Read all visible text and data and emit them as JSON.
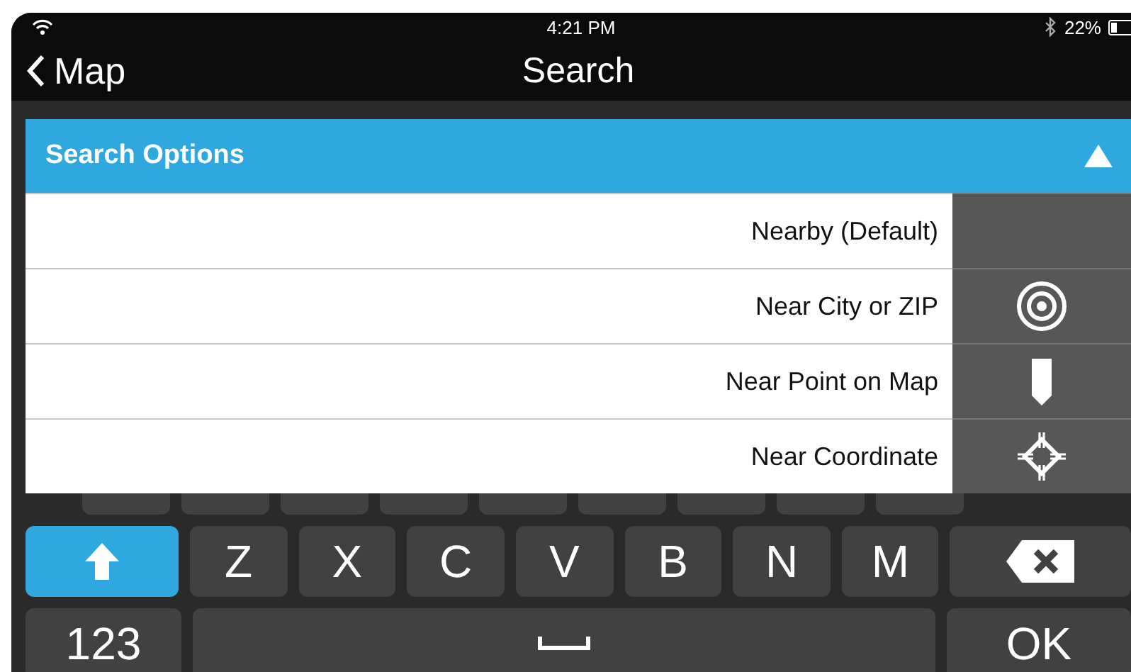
{
  "status_bar": {
    "time": "4:21 PM",
    "battery": "22%"
  },
  "nav_bar": {
    "back": "Map",
    "title": "Search"
  },
  "search_options": {
    "title": "Search Options",
    "expanded": true,
    "options": [
      {
        "label": "Nearby (Default)",
        "kind": "none"
      },
      {
        "label": "Near City or ZIP",
        "kind": "target"
      },
      {
        "label": "Near Point on Map",
        "kind": "pin"
      },
      {
        "label": "Near Coordinate",
        "kind": "crosshair"
      }
    ]
  },
  "keyboard": {
    "shift": {
      "on": true
    },
    "letters": [
      "Z",
      "X",
      "C",
      "V",
      "B",
      "N",
      "M"
    ],
    "numbers_key": "123",
    "return_key": "OK"
  }
}
